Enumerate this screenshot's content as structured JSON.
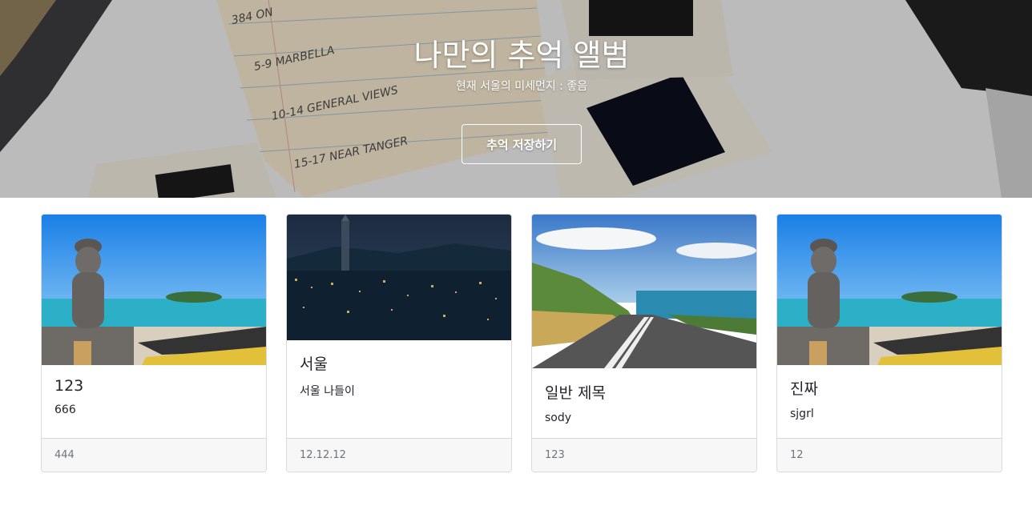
{
  "hero": {
    "title": "나만의 추억 앨범",
    "subtitle": "현재 서울의 미세먼지 : 좋음",
    "save_button_label": "추억 저장하기"
  },
  "cards": [
    {
      "title": "123",
      "text": "666",
      "footer": "444",
      "image": "jeju-harubang-beach-photo"
    },
    {
      "title": "서울",
      "text": "서울 나들이",
      "footer": "12.12.12",
      "image": "seoul-night-skyline-photo"
    },
    {
      "title": "일반 제목",
      "text": "sody",
      "footer": "123",
      "image": "coastal-road-photo"
    },
    {
      "title": "진짜",
      "text": "sjgrl",
      "footer": "12",
      "image": "jeju-harubang-beach-photo"
    }
  ],
  "colors": {
    "footer_bg": "#f7f7f7",
    "footer_text": "#6c757d",
    "card_border": "#dfdfdf"
  }
}
